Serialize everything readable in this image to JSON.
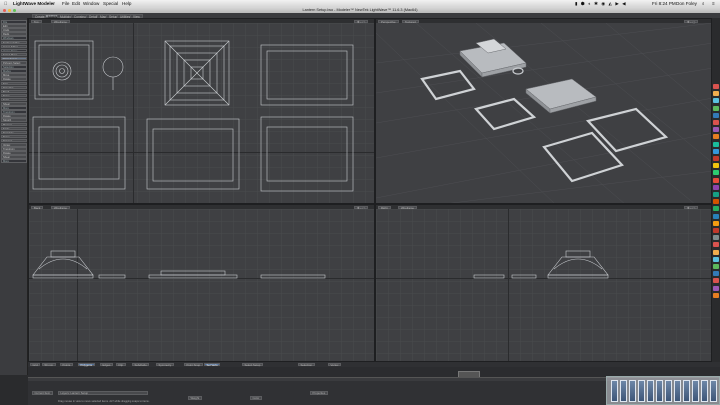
{
  "menubar": {
    "app_name": "LightWave Modeler",
    "items": [
      "File",
      "Edit",
      "Window",
      "Special",
      "Help"
    ],
    "clock": "Fri 8:24 PM",
    "user": "Don Foley"
  },
  "window": {
    "title": "Lantern Setup.lwo - Modeler™ NewTek LightWave™ 11.6.3 (Mac64)"
  },
  "tabs": [
    "Create",
    "Modify",
    "Multiply",
    "Construct",
    "Detail",
    "Map",
    "Setup",
    "Utilities",
    "View"
  ],
  "active_tab": "Modify",
  "toolbar": {
    "items": [
      {
        "label": "File",
        "kind": "head"
      },
      {
        "label": "Edit",
        "kind": "btn"
      },
      {
        "label": "Undo",
        "kind": "btn"
      },
      {
        "label": "Redo",
        "kind": "btn"
      },
      {
        "label": "Windows",
        "kind": "head"
      },
      {
        "label": "Surface Editor",
        "kind": "btn"
      },
      {
        "label": "Image Editor",
        "kind": "btn"
      },
      {
        "label": "Vertex Maps",
        "kind": "head"
      },
      {
        "label": "Select Maps",
        "kind": "btn"
      },
      {
        "label": "Point Select",
        "kind": "sel"
      },
      {
        "label": "Polygon Select",
        "kind": "btn"
      },
      {
        "label": "Selection",
        "kind": "head"
      },
      {
        "label": "Modes",
        "kind": "head"
      },
      {
        "label": "Move",
        "kind": "btn"
      },
      {
        "label": "Rotate",
        "kind": "btn"
      },
      {
        "label": "Size",
        "kind": "btn"
      },
      {
        "label": "Drag Net",
        "kind": "btn"
      },
      {
        "label": "Bend",
        "kind": "btn"
      },
      {
        "label": "Taper",
        "kind": "btn"
      },
      {
        "label": "Twist",
        "kind": "btn"
      },
      {
        "label": "Shear",
        "kind": "btn"
      },
      {
        "label": "More",
        "kind": "head"
      },
      {
        "label": "Transform",
        "kind": "head"
      },
      {
        "label": "Rotate",
        "kind": "btn"
      },
      {
        "label": "Stretch",
        "kind": "btn"
      },
      {
        "label": "Magnet",
        "kind": "btn"
      },
      {
        "label": "Scale",
        "kind": "btn"
      },
      {
        "label": "Translate",
        "kind": "btn"
      },
      {
        "label": "Taper",
        "kind": "btn"
      },
      {
        "label": "Dragnet",
        "kind": "btn"
      },
      {
        "label": "Vortex",
        "kind": "btn"
      },
      {
        "label": "Transform",
        "kind": "btn"
      },
      {
        "label": "Rotate",
        "kind": "btn"
      },
      {
        "label": "Shear",
        "kind": "btn"
      },
      {
        "label": "More",
        "kind": "head"
      }
    ]
  },
  "viewports": {
    "top_left": {
      "view": "Top",
      "mode": "Wireframe"
    },
    "top_right": {
      "view": "Perspective",
      "mode": "Textured"
    },
    "bottom_left": {
      "view": "Back",
      "mode": "Wireframe"
    },
    "bottom_right": {
      "view": "Right",
      "mode": "Wireframe"
    }
  },
  "bottombar": {
    "grid": "Grid",
    "grid_value": "50 mm",
    "buttons": [
      "Points",
      "Polygons",
      "Edges",
      "Flip",
      "Subdivide",
      "Symmetry",
      "Point Snap",
      "Sel Verts",
      "Select Setup",
      "Selection",
      "Vertex"
    ],
    "active_button": "Polygons",
    "layer_label": "Current Item",
    "layer_value": "Layers: Lantern Setup",
    "properties_label": "Properties",
    "weight_label": "Weight",
    "color_label": "Color",
    "status": "Drag mouse in view to move selected items. ALT while dragging snaps to items.",
    "frame": "1",
    "timeline_ticks": [
      "0",
      "10",
      "20",
      "30",
      "40",
      "50",
      "60",
      "70",
      "80",
      "90",
      "100",
      "110",
      "120"
    ]
  },
  "colors": {
    "accent": "#4f6f9a",
    "viewport_bg": "#3f4043",
    "wire": "#c9ccd0"
  }
}
